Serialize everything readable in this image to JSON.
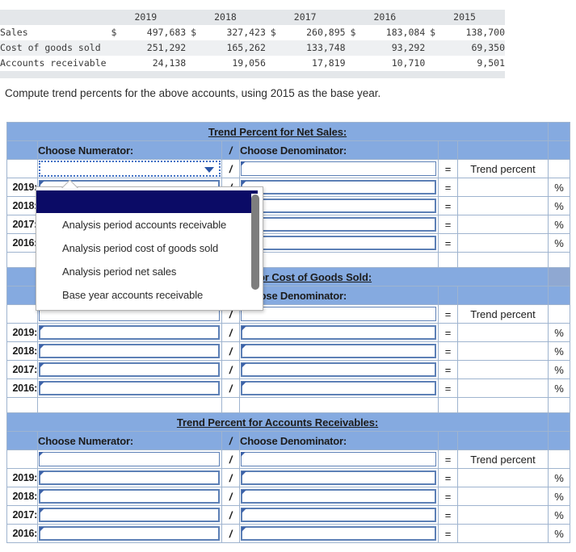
{
  "data_table": {
    "years": [
      "2019",
      "2018",
      "2017",
      "2016",
      "2015"
    ],
    "rows": [
      {
        "label": "Sales",
        "currency": [
          "$",
          "$",
          "$",
          "$",
          "$"
        ],
        "values": [
          "497,683",
          "327,423",
          "260,895",
          "183,084",
          "138,700"
        ]
      },
      {
        "label": "Cost of goods sold",
        "currency": [
          "",
          "",
          "",
          "",
          ""
        ],
        "values": [
          "251,292",
          "165,262",
          "133,748",
          "93,292",
          "69,350"
        ]
      },
      {
        "label": "Accounts receivable",
        "currency": [
          "",
          "",
          "",
          "",
          ""
        ],
        "values": [
          "24,138",
          "19,056",
          "17,819",
          "10,710",
          "9,501"
        ]
      }
    ]
  },
  "prompt": "Compute trend percents for the above accounts, using 2015 as the base year.",
  "labels": {
    "choose_numerator": "Choose Numerator:",
    "choose_denominator": "Choose Denominator:",
    "slash": "/",
    "equals": "=",
    "trend_percent": "Trend percent",
    "percent_sign": "%"
  },
  "sections": [
    {
      "title": "Trend Percent for Net Sales:",
      "years": [
        "2019:",
        "2018:",
        "2017:",
        "2016:"
      ]
    },
    {
      "title": "Trend Percent for Cost of Goods Sold:",
      "years": [
        "2019:",
        "2018:",
        "2017:",
        "2016:"
      ]
    },
    {
      "title": "Trend Percent for Accounts Receivables:",
      "years": [
        "2019:",
        "2018:",
        "2017:",
        "2016:"
      ]
    }
  ],
  "dropdown": {
    "open": true,
    "selected_value": "",
    "options": [
      "",
      "Analysis period accounts receivable",
      "Analysis period cost of goods sold",
      "Analysis period net sales",
      "Base year accounts receivable"
    ]
  },
  "colors": {
    "header_blue": "#85aae0",
    "grid_border": "#9fb4cf",
    "input_border": "#5d80b6",
    "selected_option": "#0b0b66",
    "table_shade": "#eef0f2"
  }
}
